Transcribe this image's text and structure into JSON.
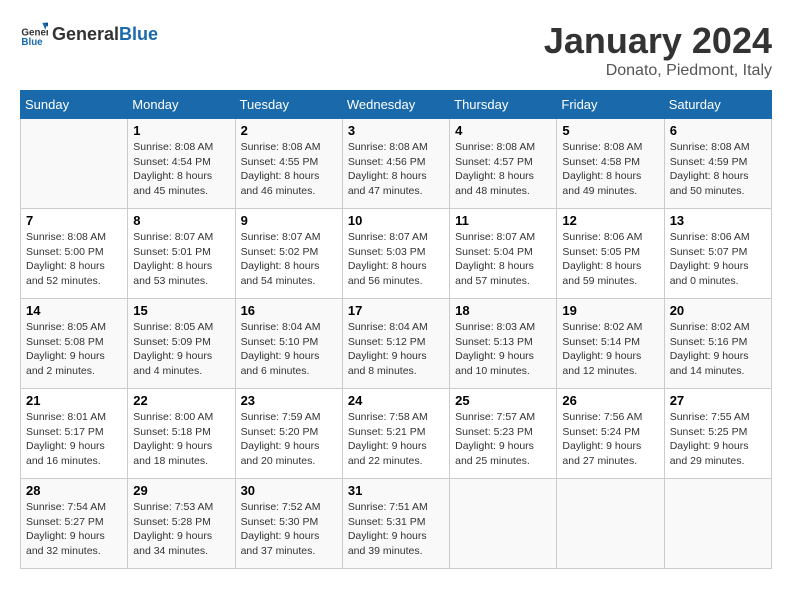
{
  "header": {
    "logo_general": "General",
    "logo_blue": "Blue",
    "month_title": "January 2024",
    "location": "Donato, Piedmont, Italy"
  },
  "weekdays": [
    "Sunday",
    "Monday",
    "Tuesday",
    "Wednesday",
    "Thursday",
    "Friday",
    "Saturday"
  ],
  "weeks": [
    [
      {
        "day": null
      },
      {
        "day": 1,
        "sunrise": "8:08 AM",
        "sunset": "4:54 PM",
        "daylight": "8 hours and 45 minutes."
      },
      {
        "day": 2,
        "sunrise": "8:08 AM",
        "sunset": "4:55 PM",
        "daylight": "8 hours and 46 minutes."
      },
      {
        "day": 3,
        "sunrise": "8:08 AM",
        "sunset": "4:56 PM",
        "daylight": "8 hours and 47 minutes."
      },
      {
        "day": 4,
        "sunrise": "8:08 AM",
        "sunset": "4:57 PM",
        "daylight": "8 hours and 48 minutes."
      },
      {
        "day": 5,
        "sunrise": "8:08 AM",
        "sunset": "4:58 PM",
        "daylight": "8 hours and 49 minutes."
      },
      {
        "day": 6,
        "sunrise": "8:08 AM",
        "sunset": "4:59 PM",
        "daylight": "8 hours and 50 minutes."
      }
    ],
    [
      {
        "day": 7,
        "sunrise": "8:08 AM",
        "sunset": "5:00 PM",
        "daylight": "8 hours and 52 minutes."
      },
      {
        "day": 8,
        "sunrise": "8:07 AM",
        "sunset": "5:01 PM",
        "daylight": "8 hours and 53 minutes."
      },
      {
        "day": 9,
        "sunrise": "8:07 AM",
        "sunset": "5:02 PM",
        "daylight": "8 hours and 54 minutes."
      },
      {
        "day": 10,
        "sunrise": "8:07 AM",
        "sunset": "5:03 PM",
        "daylight": "8 hours and 56 minutes."
      },
      {
        "day": 11,
        "sunrise": "8:07 AM",
        "sunset": "5:04 PM",
        "daylight": "8 hours and 57 minutes."
      },
      {
        "day": 12,
        "sunrise": "8:06 AM",
        "sunset": "5:05 PM",
        "daylight": "8 hours and 59 minutes."
      },
      {
        "day": 13,
        "sunrise": "8:06 AM",
        "sunset": "5:07 PM",
        "daylight": "9 hours and 0 minutes."
      }
    ],
    [
      {
        "day": 14,
        "sunrise": "8:05 AM",
        "sunset": "5:08 PM",
        "daylight": "9 hours and 2 minutes."
      },
      {
        "day": 15,
        "sunrise": "8:05 AM",
        "sunset": "5:09 PM",
        "daylight": "9 hours and 4 minutes."
      },
      {
        "day": 16,
        "sunrise": "8:04 AM",
        "sunset": "5:10 PM",
        "daylight": "9 hours and 6 minutes."
      },
      {
        "day": 17,
        "sunrise": "8:04 AM",
        "sunset": "5:12 PM",
        "daylight": "9 hours and 8 minutes."
      },
      {
        "day": 18,
        "sunrise": "8:03 AM",
        "sunset": "5:13 PM",
        "daylight": "9 hours and 10 minutes."
      },
      {
        "day": 19,
        "sunrise": "8:02 AM",
        "sunset": "5:14 PM",
        "daylight": "9 hours and 12 minutes."
      },
      {
        "day": 20,
        "sunrise": "8:02 AM",
        "sunset": "5:16 PM",
        "daylight": "9 hours and 14 minutes."
      }
    ],
    [
      {
        "day": 21,
        "sunrise": "8:01 AM",
        "sunset": "5:17 PM",
        "daylight": "9 hours and 16 minutes."
      },
      {
        "day": 22,
        "sunrise": "8:00 AM",
        "sunset": "5:18 PM",
        "daylight": "9 hours and 18 minutes."
      },
      {
        "day": 23,
        "sunrise": "7:59 AM",
        "sunset": "5:20 PM",
        "daylight": "9 hours and 20 minutes."
      },
      {
        "day": 24,
        "sunrise": "7:58 AM",
        "sunset": "5:21 PM",
        "daylight": "9 hours and 22 minutes."
      },
      {
        "day": 25,
        "sunrise": "7:57 AM",
        "sunset": "5:23 PM",
        "daylight": "9 hours and 25 minutes."
      },
      {
        "day": 26,
        "sunrise": "7:56 AM",
        "sunset": "5:24 PM",
        "daylight": "9 hours and 27 minutes."
      },
      {
        "day": 27,
        "sunrise": "7:55 AM",
        "sunset": "5:25 PM",
        "daylight": "9 hours and 29 minutes."
      }
    ],
    [
      {
        "day": 28,
        "sunrise": "7:54 AM",
        "sunset": "5:27 PM",
        "daylight": "9 hours and 32 minutes."
      },
      {
        "day": 29,
        "sunrise": "7:53 AM",
        "sunset": "5:28 PM",
        "daylight": "9 hours and 34 minutes."
      },
      {
        "day": 30,
        "sunrise": "7:52 AM",
        "sunset": "5:30 PM",
        "daylight": "9 hours and 37 minutes."
      },
      {
        "day": 31,
        "sunrise": "7:51 AM",
        "sunset": "5:31 PM",
        "daylight": "9 hours and 39 minutes."
      },
      {
        "day": null
      },
      {
        "day": null
      },
      {
        "day": null
      }
    ]
  ],
  "labels": {
    "sunrise": "Sunrise:",
    "sunset": "Sunset:",
    "daylight": "Daylight:"
  }
}
